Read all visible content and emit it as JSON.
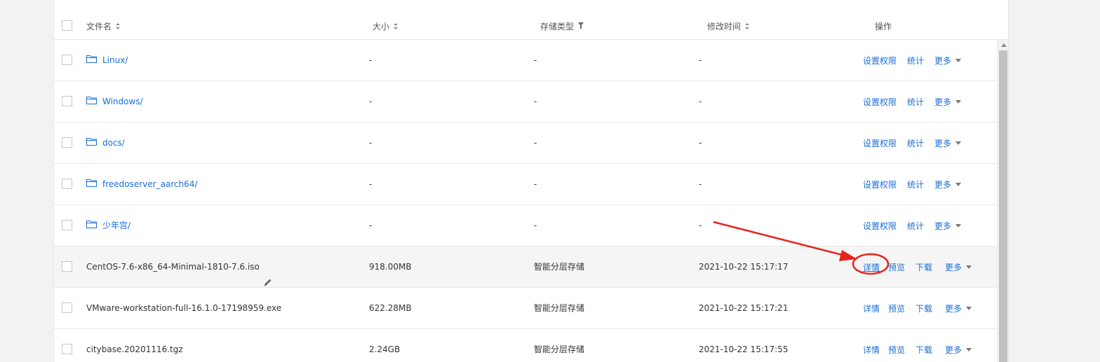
{
  "table": {
    "columns": {
      "name": "文件名",
      "size": "大小",
      "storage": "存储类型",
      "modified": "修改时间",
      "actions": "操作"
    },
    "rows": [
      {
        "name": "Linux/",
        "size": "-",
        "storage": "-",
        "modified": "-",
        "ops": [
          "设置权限",
          "统计"
        ],
        "more": "更多"
      },
      {
        "name": "Windows/",
        "size": "-",
        "storage": "-",
        "modified": "-",
        "ops": [
          "设置权限",
          "统计"
        ],
        "more": "更多"
      },
      {
        "name": "docs/",
        "size": "-",
        "storage": "-",
        "modified": "-",
        "ops": [
          "设置权限",
          "统计"
        ],
        "more": "更多"
      },
      {
        "name": "freedoserver_aarch64/",
        "size": "-",
        "storage": "-",
        "modified": "-",
        "ops": [
          "设置权限",
          "统计"
        ],
        "more": "更多"
      },
      {
        "name": "少年宫/",
        "size": "-",
        "storage": "-",
        "modified": "-",
        "ops": [
          "设置权限",
          "统计"
        ],
        "more": "更多"
      },
      {
        "name": "CentOS-7.6-x86_64-Minimal-1810-7.6.iso",
        "size": "918.00MB",
        "storage": "智能分层存储",
        "modified": "2021-10-22 15:17:17",
        "ops": [
          "详情",
          "预览",
          "下载"
        ],
        "more": "更多"
      },
      {
        "name": "VMware-workstation-full-16.1.0-17198959.exe",
        "size": "622.28MB",
        "storage": "智能分层存储",
        "modified": "2021-10-22 15:17:21",
        "ops": [
          "详情",
          "预览",
          "下载"
        ],
        "more": "更多"
      },
      {
        "name": "citybase.20201116.tgz",
        "size": "2.24GB",
        "storage": "智能分层存储",
        "modified": "2021-10-22 15:17:55",
        "ops": [
          "详情",
          "预览",
          "下载"
        ],
        "more": "更多"
      }
    ]
  },
  "colors": {
    "link": "#1a6dd6",
    "annotation": "#e8231d",
    "hover_row": "#f5f5f5"
  },
  "icons": {
    "folder": "folder-icon",
    "sort": "sort-icon",
    "filter": "filter-icon",
    "edit": "edit-pencil-icon",
    "dropdown": "caret-down-icon"
  }
}
